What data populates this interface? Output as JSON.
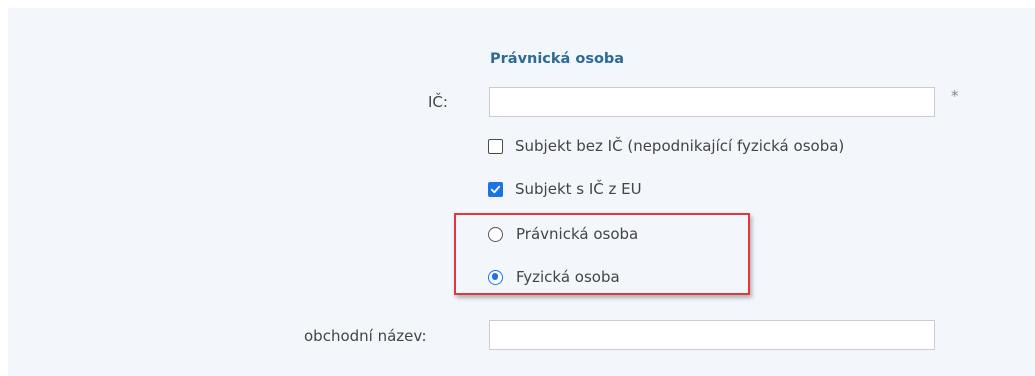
{
  "section": {
    "title": "Právnická osoba"
  },
  "ic_field": {
    "label": "IČ:",
    "value": "",
    "required_mark": "*"
  },
  "checkboxes": [
    {
      "label": "Subjekt bez IČ (nepodnikající fyzická osoba)",
      "checked": false
    },
    {
      "label": "Subjekt s IČ z EU",
      "checked": true
    }
  ],
  "radios": [
    {
      "label": "Právnická osoba",
      "selected": false
    },
    {
      "label": "Fyzická osoba",
      "selected": true
    }
  ],
  "trade_name_field": {
    "label": "obchodní název:",
    "value": ""
  },
  "colors": {
    "accent": "#1a73e8",
    "title": "#2d6b96",
    "highlight_border": "#e0383b",
    "panel_background": "#f3f7fb"
  },
  "icons": {
    "checkbox_checked": "checkmark-icon"
  }
}
